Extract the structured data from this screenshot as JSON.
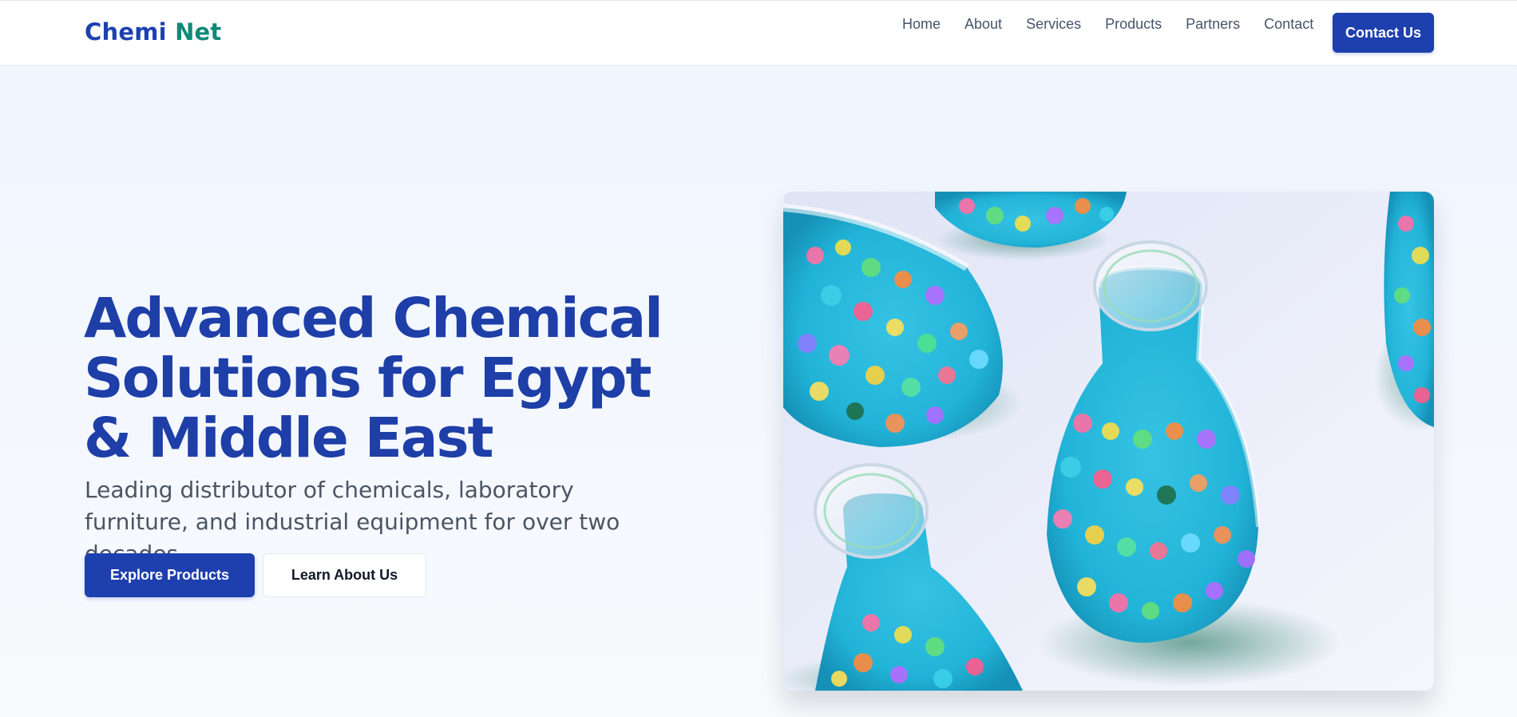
{
  "header": {
    "logo_part1": "Chemi",
    "logo_part2": "Net",
    "nav": [
      "Home",
      "About",
      "Services",
      "Products",
      "Partners",
      "Contact"
    ],
    "cta_label": "Contact Us"
  },
  "hero": {
    "title": "Advanced Chemical Solutions for Egypt & Middle East",
    "subtitle": "Leading distributor of chemicals, laboratory furniture, and industrial equipment for over two decades.",
    "primary_button": "Explore Products",
    "secondary_button": "Learn About Us"
  },
  "colors": {
    "brand_blue": "#1e3fae",
    "brand_teal": "#0f8a77",
    "hero_background": "#eff5fe"
  }
}
